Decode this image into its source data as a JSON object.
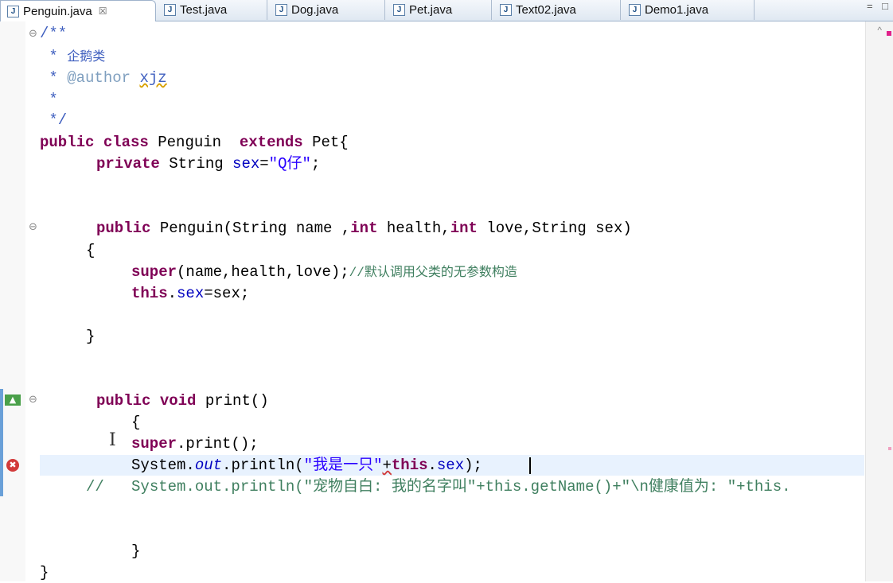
{
  "tabs": [
    {
      "label": "Penguin.java",
      "close": "☒",
      "active": true
    },
    {
      "label": "Test.java"
    },
    {
      "label": "Dog.java"
    },
    {
      "label": "Pet.java"
    },
    {
      "label": "Text02.java"
    },
    {
      "label": "Demo1.java"
    }
  ],
  "window_controls": "= □",
  "code": {
    "l1": "/**",
    "l2_star": " * ",
    "l2_text": "企鹅类",
    "l3_star": " * ",
    "l3_tag": "@author",
    "l3_name": "xjz",
    "l4": " *",
    "l5": " */",
    "l6_public": "public",
    "l6_class": "class",
    "l6_name": " Penguin  ",
    "l6_extends": "extends",
    "l6_rest": " Pet{",
    "l7_private": "private",
    "l7_type": " String ",
    "l7_field": "sex",
    "l7_eq": "=",
    "l7_str": "\"Q仔\"",
    "l7_semi": ";",
    "l8_public": "public",
    "l8_a": " Penguin(String name ,",
    "l8_int1": "int",
    "l8_b": " health,",
    "l8_int2": "int",
    "l8_c": " love,String sex)",
    "l9": "{",
    "l10_super": "super",
    "l10_args": "(name,health,love);",
    "l10_comment": "//默认调用父类的无参数构造",
    "l11_this": "this",
    "l11_dot": ".",
    "l11_field": "sex",
    "l11_rest": "=sex;",
    "l12": "}",
    "l13_public": "public",
    "l13_void": "void",
    "l13_rest": " print()",
    "l14": "{",
    "l15_super": "super",
    "l15_rest": ".print();",
    "l16_sys": "System.",
    "l16_out": "out",
    "l16_a": ".println(",
    "l16_str": "\"我是一只\"",
    "l16_plus": "+",
    "l16_this": "this",
    "l16_dot": ".",
    "l16_field": "sex",
    "l16_end": ");",
    "l17": "//   System.out.println(\"宠物自白: 我的名字叫\"+this.getName()+\"\\n健康值为: \"+this.",
    "l18": "}",
    "l19": "}"
  },
  "markers": {
    "fold": "⊖",
    "error": "✖",
    "override": "▲",
    "scroll_up": "^"
  },
  "colors": {
    "keyword": "#7f0055",
    "comment": "#3f7f5f",
    "javadoc": "#3f5fbf",
    "string": "#2a00ff",
    "field": "#0000c0",
    "current_line": "#e8f2fe",
    "error": "#d23a3a"
  }
}
